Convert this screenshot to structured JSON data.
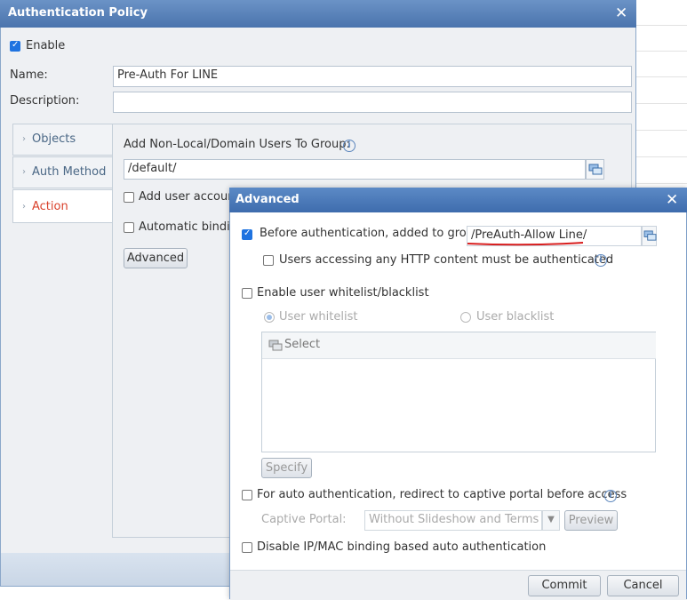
{
  "outer_dialog": {
    "title": "Authentication Policy",
    "enable_label": "Enable",
    "enable_checked": true,
    "name_label": "Name:",
    "name_value": "Pre-Auth For LINE",
    "description_label": "Description:",
    "description_value": "",
    "sidebar": [
      {
        "label": "Objects",
        "active": false
      },
      {
        "label": "Auth Method",
        "active": false
      },
      {
        "label": "Action",
        "active": true
      }
    ],
    "action_panel": {
      "add_users_label": "Add Non-Local/Domain Users To Group:",
      "group_value": "/default/",
      "add_user_account_label": "Add user accoun",
      "automatic_binding_label": "Automatic bindin",
      "advanced_button": "Advanced"
    }
  },
  "advanced_dialog": {
    "title": "Advanced",
    "before_auth_label": "Before authentication, added to group",
    "before_auth_checked": true,
    "before_auth_group": "/PreAuth-Allow Line/",
    "http_auth_label": "Users accessing any HTTP content must be authenticated",
    "whitelist_enable_label": "Enable user whitelist/blacklist",
    "whitelist_label": "User whitelist",
    "blacklist_label": "User blacklist",
    "select_label": "Select",
    "specify_button": "Specify",
    "auto_auth_label": "For auto authentication, redirect to captive portal before access",
    "captive_portal_label": "Captive Portal:",
    "captive_portal_value": "Without Slideshow and Terms of",
    "preview_button": "Preview",
    "disable_binding_label": "Disable IP/MAC binding based auto authentication",
    "commit_button": "Commit",
    "cancel_button": "Cancel"
  },
  "colors": {
    "title_bar": "#4a74ad",
    "active_tab": "#d9412b",
    "annotation_underline": "#d81e1e",
    "checkbox_on": "#1f73e0"
  }
}
